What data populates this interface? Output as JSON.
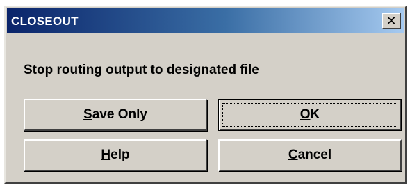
{
  "window": {
    "title": "CLOSEOUT",
    "close_icon": "close-icon"
  },
  "message": "Stop routing output to designated file",
  "buttons": {
    "save_only": {
      "mnemonic": "S",
      "rest": "ave Only"
    },
    "ok": {
      "mnemonic": "O",
      "rest": "K"
    },
    "help": {
      "mnemonic": "H",
      "rest": "elp"
    },
    "cancel": {
      "mnemonic": "C",
      "rest": "ancel"
    }
  },
  "colors": {
    "titlebar_start": "#0a246a",
    "titlebar_end": "#a6caf0",
    "dialog_face": "#d4d0c8"
  }
}
